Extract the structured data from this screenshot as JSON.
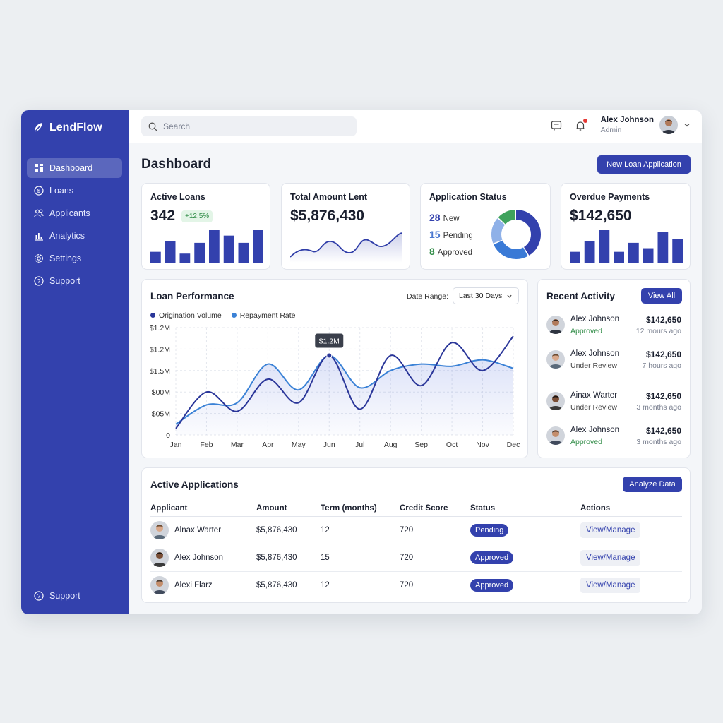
{
  "app": {
    "name": "LendFlow"
  },
  "sidebar": {
    "items": [
      {
        "label": "Dashboard",
        "icon": "grid-icon"
      },
      {
        "label": "Loans",
        "icon": "dollar-icon"
      },
      {
        "label": "Applicants",
        "icon": "users-icon"
      },
      {
        "label": "Analytics",
        "icon": "bar-chart-icon"
      },
      {
        "label": "Settings",
        "icon": "gear-icon"
      },
      {
        "label": "Support",
        "icon": "help-icon"
      }
    ],
    "footer_label": "Support"
  },
  "topbar": {
    "search_placeholder": "Search",
    "user": {
      "name": "Alex Johnson",
      "role": "Admin"
    }
  },
  "main": {
    "title": "Dashboard",
    "new_loan_label": "New Loan Application"
  },
  "kpis": {
    "active_loans": {
      "title": "Active Loans",
      "value": "342",
      "change": "+12.5%",
      "bars": [
        3,
        6,
        2.5,
        5.5,
        9,
        7.5,
        5.5,
        9
      ]
    },
    "total_lent": {
      "title": "Total Amount Lent",
      "value": "$5,876,430"
    },
    "app_status": {
      "title": "Application Status",
      "rows": [
        {
          "count": "28",
          "label": "New",
          "color": "#3341ad"
        },
        {
          "count": "15",
          "label": "Pending",
          "color": "#4a78d0"
        },
        {
          "count": "8",
          "label": "Approved",
          "color": "#2e8b45"
        }
      ],
      "donut": [
        {
          "value": 0.42,
          "color": "#3341ad"
        },
        {
          "value": 0.27,
          "color": "#3a7ad6"
        },
        {
          "value": 0.18,
          "color": "#8fb1e8"
        },
        {
          "value": 0.13,
          "color": "#3fa35d"
        }
      ]
    },
    "overdue": {
      "title": "Overdue Payments",
      "value": "$142,650",
      "bars": [
        3,
        6,
        9,
        3,
        5.5,
        4,
        8.5,
        6.5
      ]
    }
  },
  "performance": {
    "title": "Loan Performance",
    "date_range_label": "Date Range:",
    "date_range_value": "Last 30 Days",
    "tooltip": "$1.2M"
  },
  "chart_data": {
    "type": "line",
    "categories": [
      "Jan",
      "Feb",
      "Mar",
      "Apr",
      "May",
      "Jun",
      "Jul",
      "Aug",
      "Sep",
      "Oct",
      "Nov",
      "Dec"
    ],
    "y_tick_labels": [
      "$1.2M",
      "$1.2M",
      "$1.5M",
      "$00M",
      "$05M",
      "0"
    ],
    "y_max": 5,
    "series": [
      {
        "name": "Origination Volume",
        "color": "#2a3699",
        "values": [
          0.3,
          2.0,
          1.1,
          2.6,
          1.5,
          3.7,
          1.2,
          3.7,
          2.3,
          4.3,
          3.0,
          4.6
        ]
      },
      {
        "name": "Repayment Rate",
        "color": "#3b82d6",
        "values": [
          0.5,
          1.4,
          1.5,
          3.3,
          2.1,
          3.7,
          2.2,
          3.0,
          3.3,
          3.2,
          3.5,
          3.1
        ]
      }
    ],
    "highlight": {
      "index": 5,
      "label": "$1.2M"
    },
    "grid": true,
    "legend": "top-left"
  },
  "activity": {
    "title": "Recent Activity",
    "view_all_label": "View All",
    "items": [
      {
        "name": "Alex Johnson",
        "status": "Approved",
        "amount": "$142,650",
        "time": "12 mours ago",
        "status_color": "green"
      },
      {
        "name": "Alex Johnson",
        "status": "Under Review",
        "amount": "$142,650",
        "time": "7 hours ago",
        "status_color": "grey"
      },
      {
        "name": "Ainax Warter",
        "status": "Under Review",
        "amount": "$142,650",
        "time": "3 months ago",
        "status_color": "grey"
      },
      {
        "name": "Alex Johnson",
        "status": "Approved",
        "amount": "$142,650",
        "time": "3 months ago",
        "status_color": "green"
      }
    ]
  },
  "applications": {
    "title": "Active Applications",
    "analyze_label": "Analyze Data",
    "columns": [
      "Applicant",
      "Amount",
      "Term (months)",
      "Credit Score",
      "Status",
      "Actions"
    ],
    "rows": [
      {
        "applicant": "Alnax Warter",
        "amount": "$5,876,430",
        "term": "12",
        "score": "720",
        "status": "Pending",
        "action": "View/Manage"
      },
      {
        "applicant": "Alex Johnson",
        "amount": "$5,876,430",
        "term": "15",
        "score": "720",
        "status": "Approved",
        "action": "View/Manage"
      },
      {
        "applicant": "Alexi Flarz",
        "amount": "$5,876,430",
        "term": "12",
        "score": "720",
        "status": "Approved",
        "action": "View/Manage"
      }
    ]
  }
}
